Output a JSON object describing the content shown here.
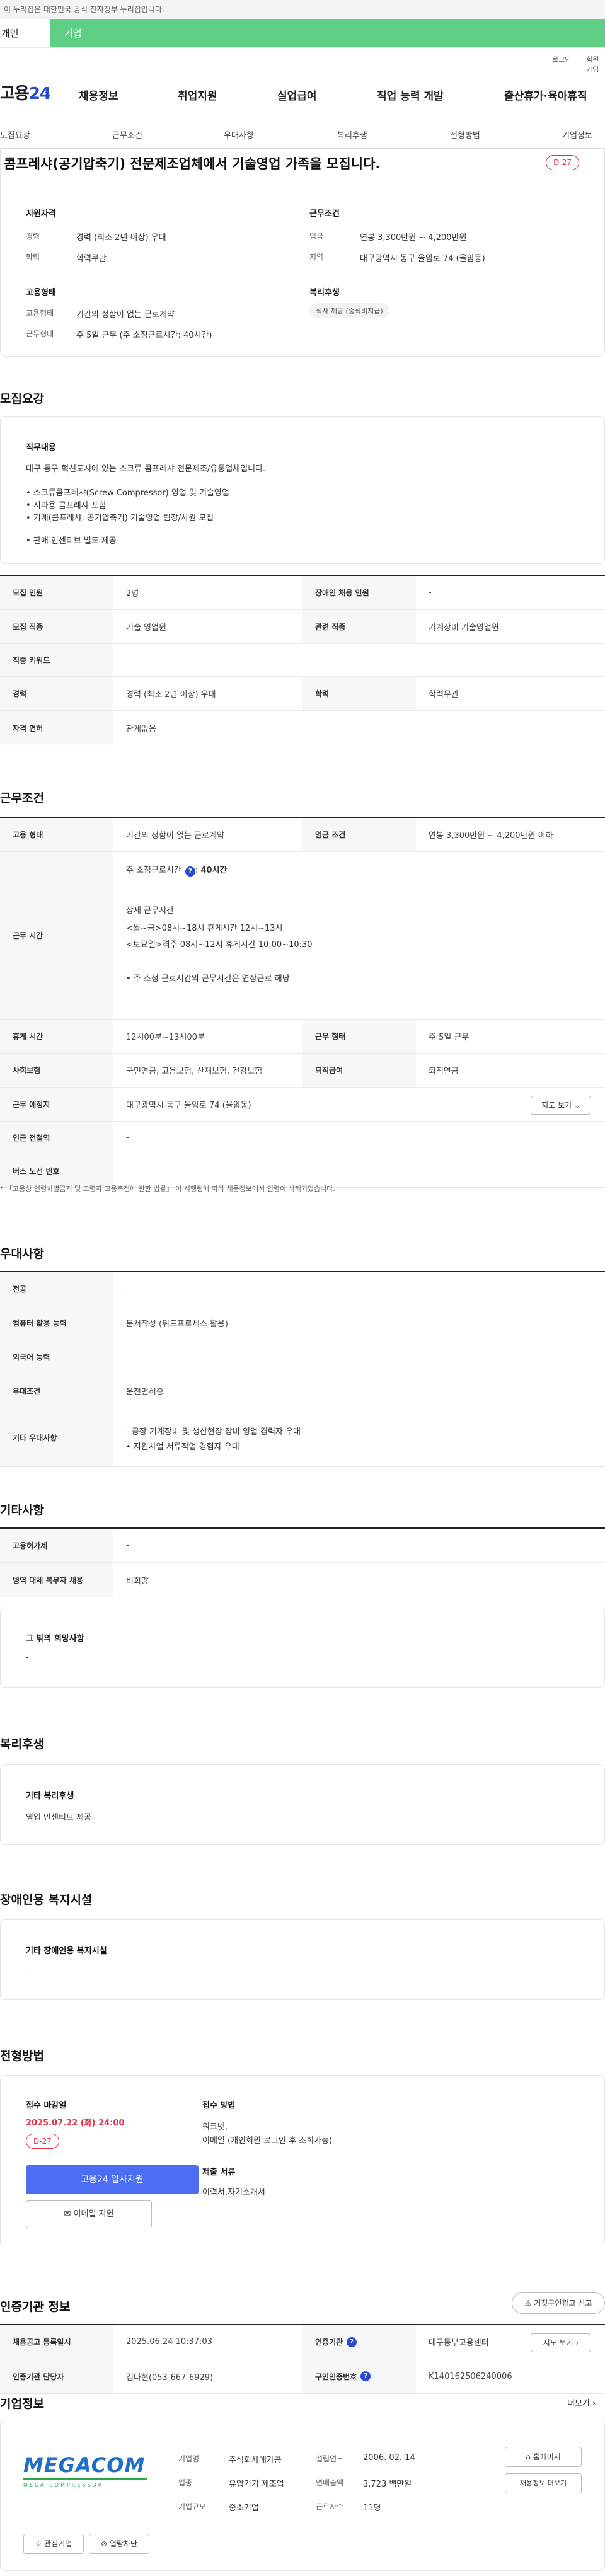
{
  "gov_banner": "이 누리집은 대한민국 공식 전자정부 누리집입니다.",
  "tabs": {
    "personal": "개인",
    "company": "기업"
  },
  "util": {
    "login": "로그인",
    "join": "회원가입"
  },
  "logo": {
    "main": "고용",
    "num": "24"
  },
  "gnb": [
    "채용정보",
    "취업지원",
    "실업급여",
    "직업 능력 개발",
    "출산휴가·육아휴직"
  ],
  "anchor": [
    "모집요강",
    "근무조건",
    "우대사항",
    "복리후생",
    "전형방법",
    "기업정보"
  ],
  "summary": {
    "title": "콤프레샤(공기압축기) 전문제조업체에서 기술영업 가족을 모집니다.",
    "dday": "D-27",
    "qual_h": "지원자격",
    "qual_career_k": "경력",
    "qual_career_v": "경력 (최소 2년 이상) 우대",
    "qual_edu_k": "학력",
    "qual_edu_v": "학력무관",
    "work_h": "근무조건",
    "work_wage_k": "임금",
    "work_wage_v": "연봉 3,300만원 ~ 4,200만원",
    "work_loc_k": "지역",
    "work_loc_v": "대구광역시 동구 율암로 74 (율암동)",
    "form_h": "고용형태",
    "form_type_k": "고용형태",
    "form_type_v": "기간의 정함이 없는 근로계약",
    "form_hours_k": "근무형태",
    "form_hours_v": "주 5일 근무 (주 소정근로시간: 40시간)",
    "welfare_h": "복리후생",
    "welfare_chip": "식사 제공 (중식비지급)"
  },
  "recruit": {
    "sec": "모집요강",
    "duty_h": "직무내용",
    "duty_1": "대구 동구 혁신도시에 있는 스크류 콤프레샤 전문제조/유통업체입니다.",
    "duty_2": "• 스크류콤프레샤(Screw Compressor) 영업 및 기술영업",
    "duty_3": "• 지과용 콤프레샤 포함",
    "duty_4": "• 기계(콤프레샤, 공기압축기) 기술영업  팀장/사원 모집",
    "duty_5": "• 판매 인센티브 별도 제공",
    "r1": [
      "모집 인원",
      "2명",
      "장애인 채용 인원",
      "-"
    ],
    "r2": [
      "모집 직종",
      "기술 영업원",
      "관련 직종",
      "기계장비 기술영업원"
    ],
    "r3": [
      "직종 키워드",
      "-"
    ],
    "r4": [
      "경력",
      "경력 (최소 2년 이상) 우대",
      "학력",
      "학력무관"
    ],
    "r5": [
      "자격 면허",
      "관계없음"
    ]
  },
  "work": {
    "sec": "근무조건",
    "r1": [
      "고용 형태",
      "기간의 정함이 없는 근로계약",
      "임금 조건",
      "연봉 3,300만원 ~ 4,200만원 이하"
    ],
    "hours_k": "근무 시간",
    "hours_1": "주 소정근로시간",
    "hours_1b": "40시간",
    "hours_2": "상세 근무시간",
    "hours_3": "<월~금>08시~18시  휴게시간 12시~13시",
    "hours_4": "<토요일>격주 08시~12시 휴게시간 10:00~10:30",
    "hours_5": "• 주 소정 근로시간의 근무시간은 연장근로 해당",
    "r3": [
      "휴게 시간",
      "12시00분~13시00분",
      "근무 형태",
      "주 5일 근무"
    ],
    "r4": [
      "사회보험",
      "국민연금, 고용보험, 산재보험, 건강보험",
      "퇴직급여",
      "퇴직연금"
    ],
    "r5": [
      "근무 예정지",
      "대구광역시 동구 율암로 74 (율암동)"
    ],
    "map_btn": "지도 보기",
    "r6": [
      "인근 전철역",
      "-"
    ],
    "r7": [
      "버스 노선 번호",
      "-"
    ],
    "note": "* 「고용상 연령차별금지 및 고령자 고용촉진에 관한 법률」 이 시행됨에 따라 채용정보에서 연령이 삭제되었습니다."
  },
  "pref": {
    "sec": "우대사항",
    "r1": [
      "전공",
      "-"
    ],
    "r2": [
      "컴퓨터 활용 능력",
      "문서작성 (워드프로세스 활용)"
    ],
    "r3": [
      "외국어 능력",
      "-"
    ],
    "r4": [
      "우대조건",
      "운전면허증"
    ],
    "r5k": "기타 우대사항",
    "r5a": "- 공장 기계장비 및 생산현장 장비 영업 경력자 우대",
    "r5b": "• 지원사업 서류작업 경험자 우대"
  },
  "etc": {
    "sec": "기타사항",
    "r1": [
      "고용허가제",
      "-"
    ],
    "r2": [
      "병역 대체 복무자 채용",
      "비희망"
    ],
    "hope_h": "그 밖의 희망사항",
    "hope_v": "-"
  },
  "welfare": {
    "sec": "복리후생",
    "h": "기타 복리후생",
    "v": "영업 인센티브 제공"
  },
  "disab": {
    "sec": "장애인용 복지시설",
    "h": "기타 장애인용 복지시설",
    "v": "-"
  },
  "apply": {
    "sec": "전형방법",
    "deadline_h": "접수 마감일",
    "deadline_v": "2025.07.22 (화) 24:00",
    "dday": "D-27",
    "btn_apply": "고용24 입사지원",
    "btn_email": "이메일 지원",
    "method_h": "접수 방법",
    "method_1": "워크넷,",
    "method_2": "이메일 (개인회원 로그인 후 조회가능)",
    "docs_h": "제출 서류",
    "docs_v": "이력서,자기소개서"
  },
  "agency": {
    "sec": "인증기관 정보",
    "report_btn": "거짓구인광고 신고",
    "r1": [
      "채용공고 등록일시",
      "2025.06.24 10:37:03",
      "인증기관",
      "대구동부고용센터"
    ],
    "map_btn": "지도 보기",
    "r2": [
      "인증기관 담당자",
      "김나현(053-667-6929)",
      "구인인증번호",
      "K140162506240006"
    ]
  },
  "company": {
    "sec": "기업정보",
    "more": "더보기",
    "logo_text": "MEGACOM",
    "logo_sub": "MEGA COMPRESSOR",
    "f1k": "기업명",
    "f1v": "주식회사메가콤",
    "f2k": "업종",
    "f2v": "유압기기 제조업",
    "f3k": "기업규모",
    "f3v": "중소기업",
    "g1k": "설립연도",
    "g1v": "2006. 02. 14",
    "g2k": "연매출액",
    "g2v": "3,723 백만원",
    "g3k": "근로자수",
    "g3v": "11명",
    "btn_home": "홈페이지",
    "btn_more": "채용정보 더보기",
    "btn_fav": "관심기업",
    "btn_block": "열람차단"
  }
}
